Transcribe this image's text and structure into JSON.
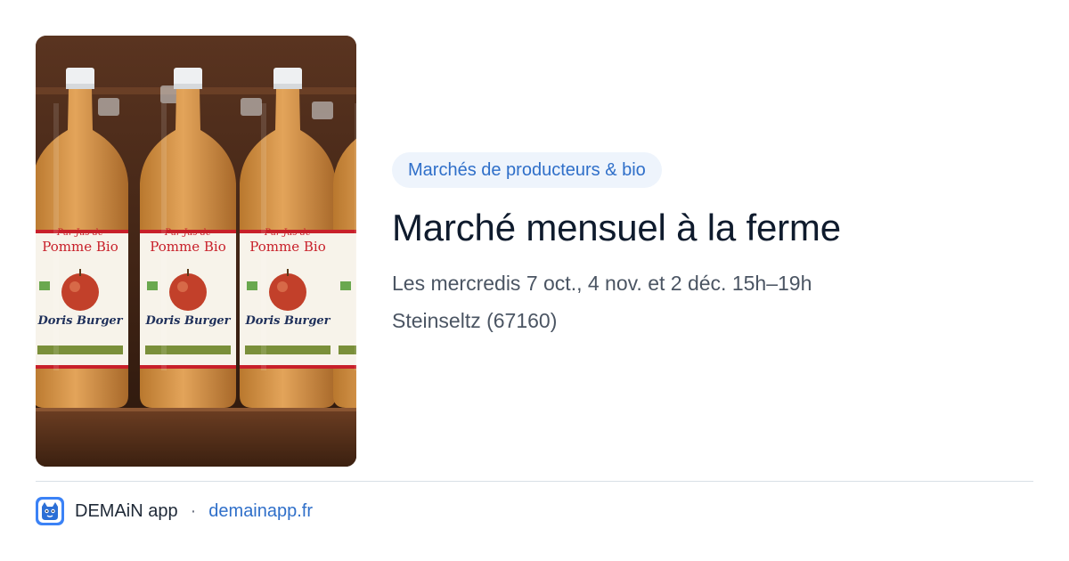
{
  "event": {
    "image_alt": "Bouteilles de jus de pomme bio",
    "bottle_label": {
      "line1": "Pur Jus de",
      "line2": "Pomme Bio",
      "producer": "Doris Burger"
    },
    "category": "Marchés de producteurs & bio",
    "title": "Marché mensuel à la ferme",
    "dates": "Les mercredis 7 oct., 4 nov. et 2 déc. 15h–19h",
    "location": "Steinseltz (67160)"
  },
  "footer": {
    "logo_icon": "demain-app-logo-icon",
    "app_name": "DEMAiN app",
    "separator": "·",
    "link_text": "demainapp.fr"
  },
  "colors": {
    "accent": "#2f6fc9",
    "tag_bg": "#eef4fc",
    "title": "#0f1b2d",
    "meta": "#4b5563"
  }
}
